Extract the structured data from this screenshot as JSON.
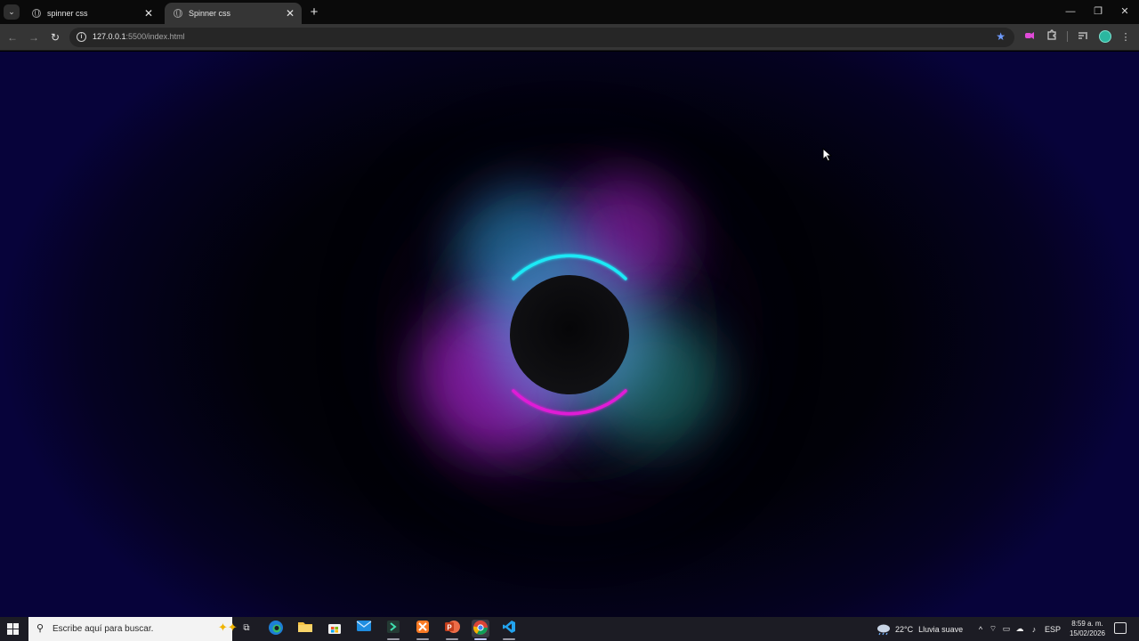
{
  "browser": {
    "tab_search_glyph": "⌄",
    "tabs": [
      {
        "title": "spinner css",
        "active": false
      },
      {
        "title": "Spinner css",
        "active": true
      }
    ],
    "new_tab_glyph": "+",
    "window_controls": {
      "minimize": "—",
      "restore": "❐",
      "close": "✕"
    },
    "nav": {
      "back": "←",
      "forward": "→",
      "reload": "↻"
    },
    "address": {
      "host": "127.0.0.1",
      "rest": ":5500/index.html"
    },
    "toolbar_icons": [
      "extension-pink-icon",
      "puzzle-icon",
      "reading-list-icon",
      "profile-avatar",
      "menu-dots-icon"
    ]
  },
  "page": {
    "background_color": "#000000",
    "edge_color": "#07033a",
    "spinner": {
      "top_arc_color": "#1de9f6",
      "bottom_arc_color": "#e01bd6",
      "core_color": "#0b0b0d",
      "glow_colors": [
        "#8a1aa8",
        "#3ca0d8",
        "#1a7a70",
        "#c01ad0"
      ]
    }
  },
  "taskbar": {
    "search_placeholder": "Escribe aquí para buscar.",
    "apps": [
      "task-view-icon",
      "edge-icon",
      "file-explorer-icon",
      "store-icon",
      "mail-icon",
      "terminal-app-icon",
      "xampp-icon",
      "powerpoint-icon",
      "chrome-icon",
      "vscode-icon"
    ],
    "weather": {
      "temperature": "22°C",
      "condition": "Lluvia suave"
    },
    "language": "ESP",
    "time": "8:59 a. m.",
    "date": "15/02/2026"
  }
}
